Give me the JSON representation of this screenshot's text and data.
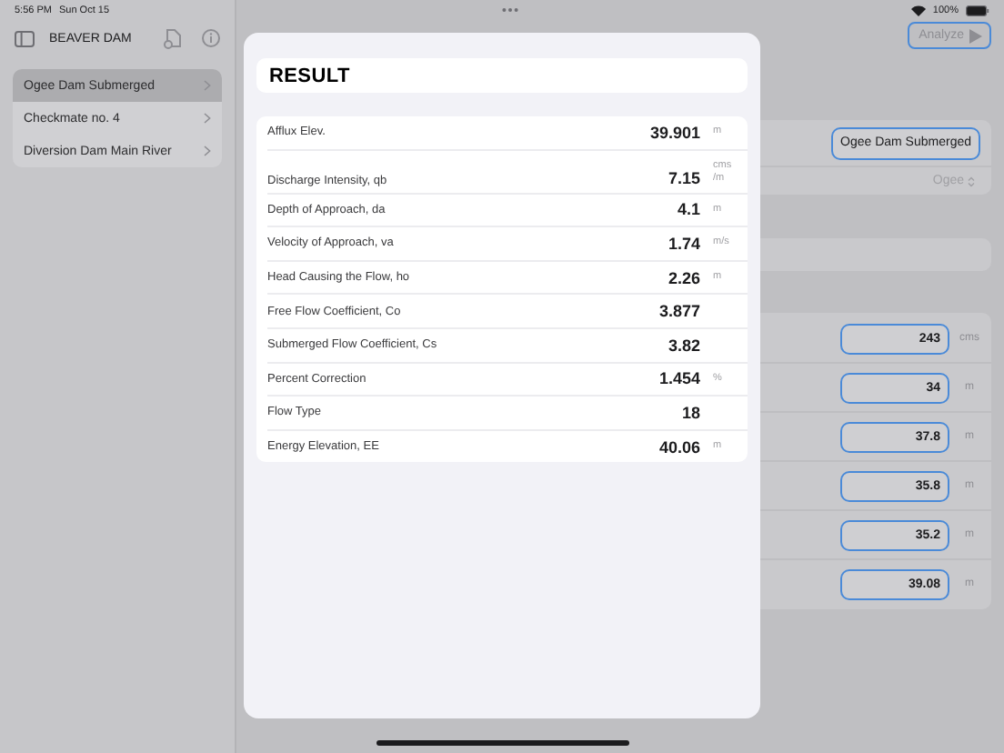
{
  "status_bar": {
    "time": "5:56 PM",
    "date": "Sun Oct 15",
    "battery": "100%"
  },
  "sidebar": {
    "title": "BEAVER DAM",
    "items": [
      {
        "label": "Ogee Dam Submerged",
        "selected": true
      },
      {
        "label": "Checkmate no. 4",
        "selected": false
      },
      {
        "label": "Diversion Dam Main River",
        "selected": false
      }
    ]
  },
  "toolbar": {
    "analyze_button": "Analyze"
  },
  "main": {
    "type_button": "Ogee Dam Submerged",
    "type_picker": "Ogee",
    "inputs": [
      {
        "value": "243",
        "unit": "cms"
      },
      {
        "value": "34",
        "unit": "m"
      },
      {
        "value": "37.8",
        "unit": "m"
      },
      {
        "value": "35.8",
        "unit": "m"
      },
      {
        "value": "35.2",
        "unit": "m"
      },
      {
        "value": "39.08",
        "unit": "m"
      }
    ]
  },
  "result": {
    "title": "RESULT",
    "rows": [
      {
        "label": "Afflux Elev.",
        "value": "39.901",
        "unit": "m"
      },
      {
        "label": "Discharge Intensity, qb",
        "value": "7.15",
        "unit": "cms /m"
      },
      {
        "label": "Depth of Approach, da",
        "value": "4.1",
        "unit": "m"
      },
      {
        "label": "Velocity of Approach, va",
        "value": "1.74",
        "unit": "m/s"
      },
      {
        "label": "Head Causing the Flow, ho",
        "value": "2.26",
        "unit": "m"
      },
      {
        "label": "Free Flow Coefficient, Co",
        "value": "3.877"
      },
      {
        "label": "Submerged Flow Coefficient, Cs",
        "value": "3.82"
      },
      {
        "label": "Percent Correction",
        "value": "1.454",
        "unit": "%"
      },
      {
        "label": "Flow Type",
        "value": "18"
      },
      {
        "label": "Energy Elevation, EE",
        "value": "40.06",
        "unit": "m"
      }
    ]
  }
}
